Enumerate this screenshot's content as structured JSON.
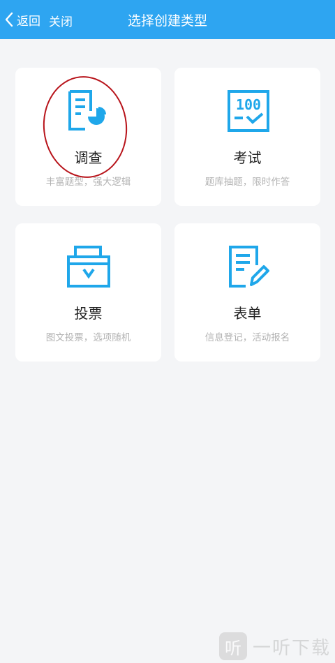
{
  "header": {
    "back_label": "返回",
    "close_label": "关闭",
    "title": "选择创建类型"
  },
  "cards": [
    {
      "title": "调查",
      "subtitle": "丰富题型，强大逻辑",
      "icon": "survey-chart-icon",
      "highlighted": true
    },
    {
      "title": "考试",
      "subtitle": "题库抽题，限时作答",
      "icon": "exam-score-icon"
    },
    {
      "title": "投票",
      "subtitle": "图文投票，选项随机",
      "icon": "vote-box-icon"
    },
    {
      "title": "表单",
      "subtitle": "信息登记，活动报名",
      "icon": "form-edit-icon"
    }
  ],
  "watermark": {
    "logo_char": "听",
    "text": "一听下载"
  },
  "colors": {
    "header": "#2ea5f1",
    "icon": "#1fa7ea",
    "highlight": "#b8141b",
    "background": "#f4f5f7"
  }
}
